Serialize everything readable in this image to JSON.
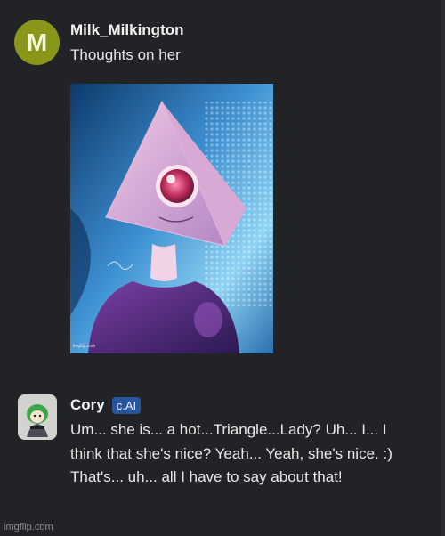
{
  "post": {
    "avatar_letter": "M",
    "avatar_color": "#8a9619",
    "username": "Milk_Milkington",
    "message": "Thoughts on her",
    "image": {
      "subject": "pyramid-headed-cyclops-woman-artwork",
      "watermark": "imgflip.com"
    }
  },
  "reply": {
    "username": "Cory",
    "badge": "c.AI",
    "badge_color": "#27569e",
    "message": "Um... she is... a hot...Triangle...Lady? Uh... I... I think that she's nice? Yeah... Yeah, she's nice. :) That's... uh... all I have to say about that!"
  },
  "footer": {
    "watermark": "imgflip.com"
  }
}
